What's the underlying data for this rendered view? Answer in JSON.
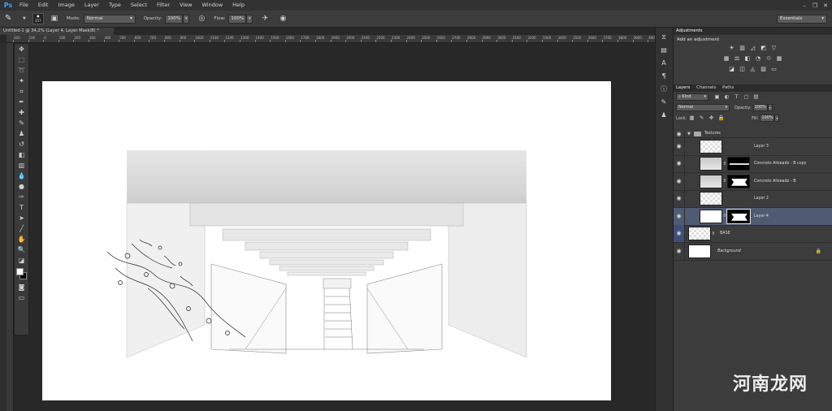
{
  "menubar": {
    "logo": "Ps",
    "items": [
      "File",
      "Edit",
      "Image",
      "Layer",
      "Type",
      "Select",
      "Filter",
      "View",
      "Window",
      "Help"
    ]
  },
  "options": {
    "brush_size": "357",
    "mode_label": "Mode:",
    "mode_value": "Normal",
    "opacity_label": "Opacity:",
    "opacity_value": "100%",
    "flow_label": "Flow:",
    "flow_value": "100%",
    "workspace": "Essentials"
  },
  "document_tab": "Untitled-1 @ 34,2% (Layer 4, Layer Mask/8) *",
  "ruler_ticks": [
    "200",
    "100",
    "0",
    "100",
    "200",
    "300",
    "400",
    "500",
    "600",
    "700",
    "800",
    "900",
    "1000",
    "1100",
    "1200",
    "1300",
    "1400",
    "1500",
    "1600",
    "1700",
    "1800",
    "1900",
    "2000",
    "2100",
    "2200",
    "2300",
    "2400",
    "2500",
    "2600",
    "2700",
    "2800",
    "2900",
    "3000",
    "3100",
    "3200",
    "3300",
    "3400",
    "3500",
    "3600",
    "3700",
    "3800",
    "3900",
    "4000"
  ],
  "adjustments": {
    "tab": "Adjustments",
    "title": "Add an adjustment"
  },
  "layers": {
    "tabs": [
      "Layers",
      "Channels",
      "Paths"
    ],
    "kind_label": "Kind",
    "blend_mode": "Normal",
    "opacity_label": "Opacity:",
    "opacity_value": "100%",
    "lock_label": "Lock:",
    "fill_label": "Fill:",
    "fill_value": "100%",
    "group_name": "Textures",
    "items": [
      {
        "name": "Layer 3"
      },
      {
        "name": "Concreto Aliseado - B copy"
      },
      {
        "name": "Concreto Aliseado - B"
      },
      {
        "name": "Layer 2"
      },
      {
        "name": "Layer 4"
      },
      {
        "name": "BASE"
      },
      {
        "name": "Background"
      }
    ]
  },
  "watermark": "河南龙网"
}
